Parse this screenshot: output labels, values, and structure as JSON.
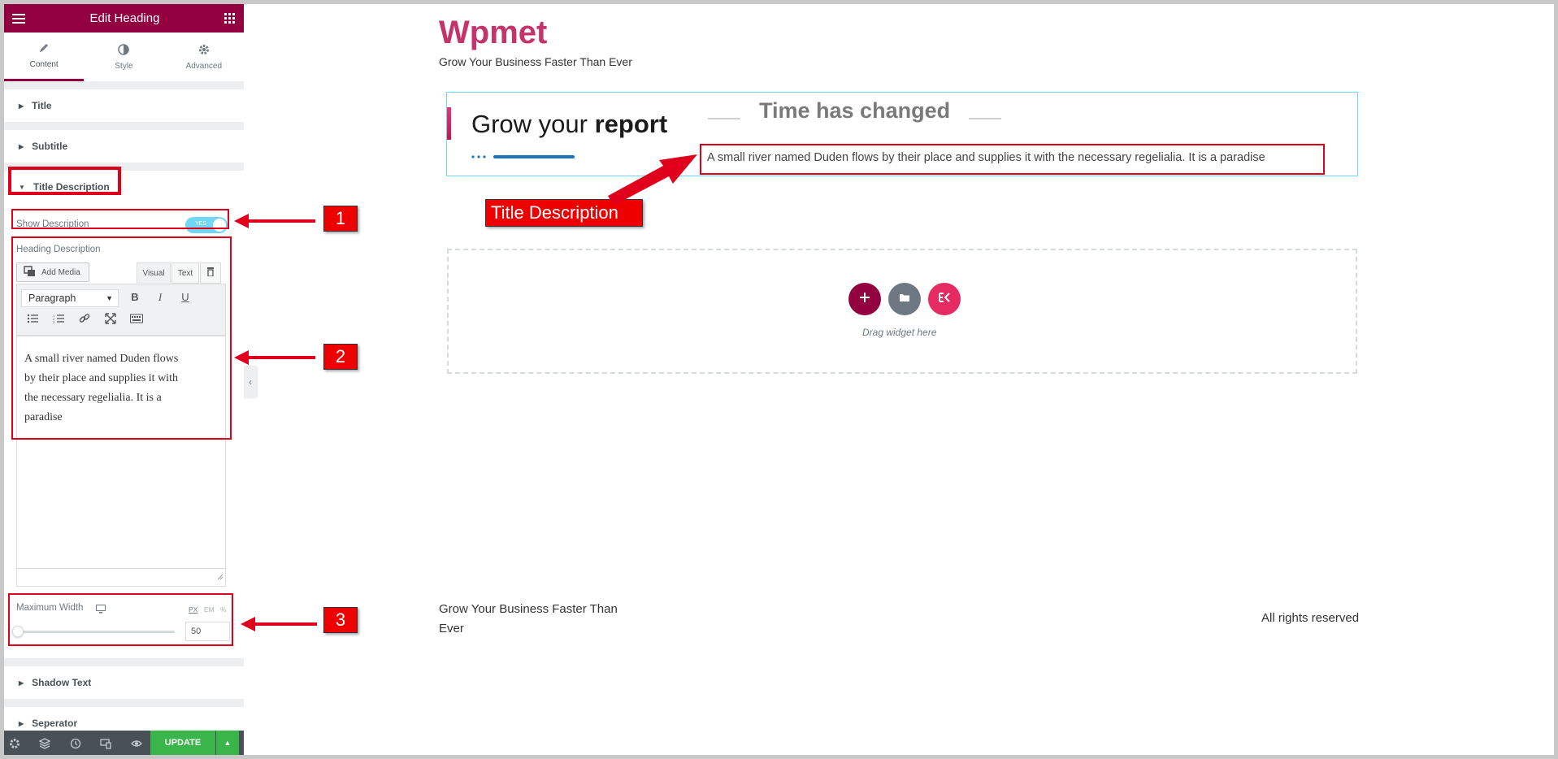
{
  "panel": {
    "title": "Edit Heading",
    "tabs": [
      {
        "label": "Content",
        "icon": "pencil-icon"
      },
      {
        "label": "Style",
        "icon": "half-circle-icon"
      },
      {
        "label": "Advanced",
        "icon": "gear-icon"
      }
    ],
    "sections": {
      "title": "Title",
      "subtitle": "Subtitle",
      "title_description": "Title Description",
      "shadow_text": "Shadow Text",
      "seperator": "Seperator"
    },
    "show_description": {
      "label": "Show Description",
      "toggle": "YES",
      "state": "on"
    },
    "heading_description": {
      "label": "Heading Description",
      "add_media": "Add Media",
      "visual_tab": "Visual",
      "text_tab": "Text",
      "format": "Paragraph",
      "content_lines": [
        "A small river named Duden flows",
        "by their place and supplies it with",
        "the necessary regelialia. It is a",
        "paradise"
      ]
    },
    "max_width": {
      "label": "Maximum Width",
      "units": [
        "PX",
        "EM",
        "%"
      ],
      "active_unit": "PX",
      "value": "50"
    },
    "update_label": "UPDATE"
  },
  "canvas": {
    "site_title": "Wpmet",
    "site_tagline": "Grow Your Business Faster Than Ever",
    "heading_normal": "Grow your ",
    "heading_bold": "report",
    "subtitle": "Time has changed",
    "description": "A small river named Duden flows by their place and supplies it with the necessary regelialia. It is a paradise",
    "drag_text": "Drag widget here",
    "footer_left": "Grow Your Business Faster Than Ever",
    "footer_right": "All rights reserved"
  },
  "annotations": {
    "badge_1": "1",
    "badge_2": "2",
    "badge_3": "3",
    "callout": "Title Description"
  },
  "colors": {
    "brand": "#93003f",
    "accent_pink": "#c4336a",
    "annotation_red": "#e0001b",
    "toggle_on": "#71d7f7",
    "update_green": "#39b54a"
  }
}
